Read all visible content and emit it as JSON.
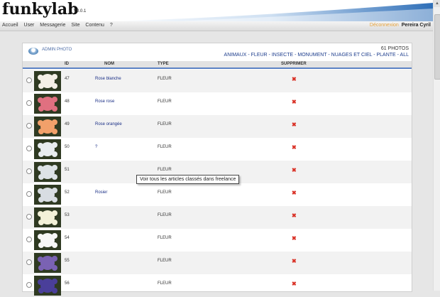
{
  "app": {
    "logo": "funkylab",
    "version": "V0.0.1"
  },
  "menu": [
    "Accueil",
    "User",
    "Messagerie",
    "Site",
    "Contenu",
    "?"
  ],
  "user": {
    "logout_label": "Déconnexion",
    "name": "Pereira Cyril"
  },
  "panel": {
    "title": "ADMIN PHOTO",
    "count": "61 PHOTOS",
    "categories": "ANIMAUX - FLEUR - INSECTE - MONUMENT - NUAGES ET CIEL - PLANTE - ALL"
  },
  "table": {
    "columns": [
      "ID",
      "NOM",
      "TYPE",
      "SUPPRIMER"
    ],
    "rows": [
      {
        "id": "47",
        "nom": "Rose blanche",
        "type": "FLEUR",
        "del": "✖",
        "thumb_color": "#f4efe6"
      },
      {
        "id": "48",
        "nom": "Rose rose",
        "type": "FLEUR",
        "del": "✖",
        "thumb_color": "#e07080"
      },
      {
        "id": "49",
        "nom": "Rose orangée",
        "type": "FLEUR",
        "del": "✖",
        "thumb_color": "#f2a06a"
      },
      {
        "id": "50",
        "nom": "?",
        "type": "FLEUR",
        "del": "✖",
        "thumb_color": "#e8ecef"
      },
      {
        "id": "51",
        "nom": "",
        "type": "FLEUR",
        "del": "✖",
        "thumb_color": "#dde2e6"
      },
      {
        "id": "52",
        "nom": "Rosier",
        "type": "FLEUR",
        "del": "✖",
        "thumb_color": "#d8dde2"
      },
      {
        "id": "53",
        "nom": "",
        "type": "FLEUR",
        "del": "✖",
        "thumb_color": "#f3f1d8"
      },
      {
        "id": "54",
        "nom": "",
        "type": "FLEUR",
        "del": "✖",
        "thumb_color": "#f7f7f7"
      },
      {
        "id": "55",
        "nom": "",
        "type": "FLEUR",
        "del": "✖",
        "thumb_color": "#7a62b3"
      },
      {
        "id": "56",
        "nom": "",
        "type": "FLEUR",
        "del": "✖",
        "thumb_color": "#4a3f9a"
      }
    ]
  },
  "tooltip": "Voir tous les articles classés dans freelance",
  "colors": {
    "accent": "#5b82c4",
    "logout": "#e7a23a",
    "delete": "#d93025",
    "link": "#1a2f86"
  }
}
